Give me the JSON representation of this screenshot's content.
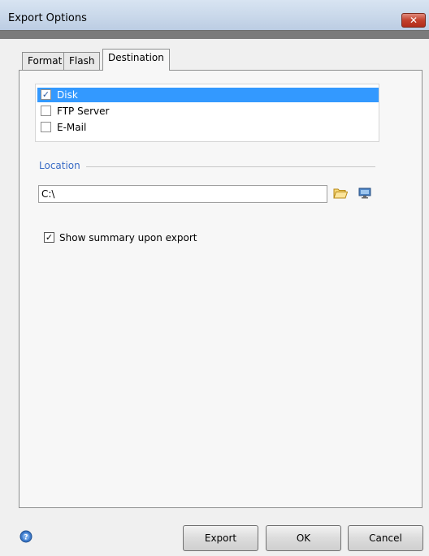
{
  "window": {
    "title": "Export Options",
    "close_label": "✕"
  },
  "tabs": [
    {
      "label": "Format",
      "active": false
    },
    {
      "label": "Flash",
      "active": false
    },
    {
      "label": "Destination",
      "active": true
    }
  ],
  "destinations": [
    {
      "label": "Disk",
      "checked": true,
      "selected": true,
      "check_mark": "✓"
    },
    {
      "label": "FTP Server",
      "checked": false,
      "selected": false,
      "check_mark": ""
    },
    {
      "label": "E-Mail",
      "checked": false,
      "selected": false,
      "check_mark": ""
    }
  ],
  "location": {
    "section_label": "Location",
    "value": "C:\\",
    "folder_icon": "folder-open-icon",
    "monitor_icon": "monitor-icon"
  },
  "summary": {
    "label": "Show summary upon export",
    "checked": true,
    "check_mark": "✓"
  },
  "footer": {
    "help_icon": "help-icon",
    "export_label": "Export",
    "ok_label": "OK",
    "cancel_label": "Cancel"
  },
  "colors": {
    "selection": "#3399ff",
    "section_label": "#3a6cc6",
    "close_button": "#c2402c"
  }
}
